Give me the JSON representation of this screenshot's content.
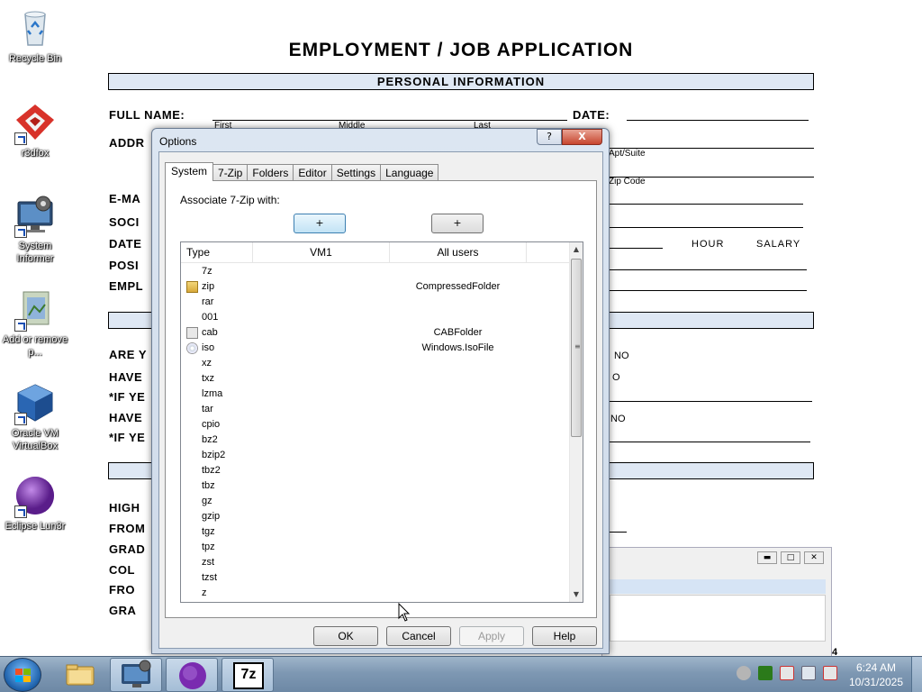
{
  "form": {
    "title": "EMPLOYMENT / JOB APPLICATION",
    "section_personal": "PERSONAL INFORMATION",
    "full_name_label": "FULL NAME:",
    "date_label": "DATE:",
    "first_label": "First",
    "middle_label": "Middle",
    "last_label": "Last",
    "address_label_partial": "ADDR",
    "apt_suite_label": "Apt/Suite",
    "zip_code_label": "Zip Code",
    "email_label_partial": "E-MA",
    "social_label_partial": "SOCI",
    "date2_label_partial": "DATE",
    "hour_label": "HOUR",
    "salary_label": "SALARY",
    "position_label_partial": "POSI",
    "employment_label_partial": "EMPL",
    "are_label_partial": "ARE Y",
    "have1_label_partial": "HAVE",
    "ifyes1_label_partial": "*IF YE",
    "have2_label_partial": "HAVE",
    "ifyes2_label_partial": "*IF YE",
    "no1": "NO",
    "d1": "O",
    "no2": "NO",
    "high_partial": "HIGH",
    "from1_partial": "FROM",
    "grad1_partial": "GRAD",
    "col_partial": "COL",
    "from2_partial": "FRO",
    "grad2_partial": "GRA",
    "corner_digit": "4"
  },
  "desktop_icons": [
    {
      "label": "Recycle Bin",
      "icon": "recycle-bin-icon"
    },
    {
      "label": "r3dfox",
      "icon": "r3dfox-icon"
    },
    {
      "label": "System Informer",
      "icon": "system-informer-icon"
    },
    {
      "label": "Add or remove p...",
      "icon": "add-remove-programs-icon"
    },
    {
      "label": "Oracle VM VirtualBox",
      "icon": "virtualbox-icon"
    },
    {
      "label": "Eclipse Lun3r",
      "icon": "eclipse-icon"
    }
  ],
  "dialog": {
    "title": "Options",
    "help_glyph": "?",
    "close_glyph": "X",
    "tabs": [
      "System",
      "7-Zip",
      "Folders",
      "Editor",
      "Settings",
      "Language"
    ],
    "active_tab": "System",
    "associate_label": "Associate 7-Zip with:",
    "plus_button_1": "+",
    "plus_button_2": "+",
    "columns": [
      "Type",
      "VM1",
      "All users"
    ],
    "rows": [
      {
        "type": "7z",
        "vm1": "",
        "all_users": "",
        "icon": "none"
      },
      {
        "type": "zip",
        "vm1": "",
        "all_users": "CompressedFolder",
        "icon": "zip-folder-icon"
      },
      {
        "type": "rar",
        "vm1": "",
        "all_users": "",
        "icon": "none"
      },
      {
        "type": "001",
        "vm1": "",
        "all_users": "",
        "icon": "none"
      },
      {
        "type": "cab",
        "vm1": "",
        "all_users": "CABFolder",
        "icon": "cab-icon"
      },
      {
        "type": "iso",
        "vm1": "",
        "all_users": "Windows.IsoFile",
        "icon": "iso-icon"
      },
      {
        "type": "xz",
        "vm1": "",
        "all_users": "",
        "icon": "none"
      },
      {
        "type": "txz",
        "vm1": "",
        "all_users": "",
        "icon": "none"
      },
      {
        "type": "lzma",
        "vm1": "",
        "all_users": "",
        "icon": "none"
      },
      {
        "type": "tar",
        "vm1": "",
        "all_users": "",
        "icon": "none"
      },
      {
        "type": "cpio",
        "vm1": "",
        "all_users": "",
        "icon": "none"
      },
      {
        "type": "bz2",
        "vm1": "",
        "all_users": "",
        "icon": "none"
      },
      {
        "type": "bzip2",
        "vm1": "",
        "all_users": "",
        "icon": "none"
      },
      {
        "type": "tbz2",
        "vm1": "",
        "all_users": "",
        "icon": "none"
      },
      {
        "type": "tbz",
        "vm1": "",
        "all_users": "",
        "icon": "none"
      },
      {
        "type": "gz",
        "vm1": "",
        "all_users": "",
        "icon": "none"
      },
      {
        "type": "gzip",
        "vm1": "",
        "all_users": "",
        "icon": "none"
      },
      {
        "type": "tgz",
        "vm1": "",
        "all_users": "",
        "icon": "none"
      },
      {
        "type": "tpz",
        "vm1": "",
        "all_users": "",
        "icon": "none"
      },
      {
        "type": "zst",
        "vm1": "",
        "all_users": "",
        "icon": "none"
      },
      {
        "type": "tzst",
        "vm1": "",
        "all_users": "",
        "icon": "none"
      },
      {
        "type": "z",
        "vm1": "",
        "all_users": "",
        "icon": "none"
      }
    ],
    "buttons": {
      "ok": "OK",
      "cancel": "Cancel",
      "apply": "Apply",
      "help": "Help"
    }
  },
  "taskbar": {
    "clock_time": "6:24 AM",
    "clock_date": "10/31/2025",
    "sevenzip_label": "7z"
  },
  "colors": {
    "taskbar": "#7e98b3",
    "dialog_frame": "#cdd9e8",
    "close_button": "#c7452e",
    "form_bar": "#dfe8f4"
  }
}
